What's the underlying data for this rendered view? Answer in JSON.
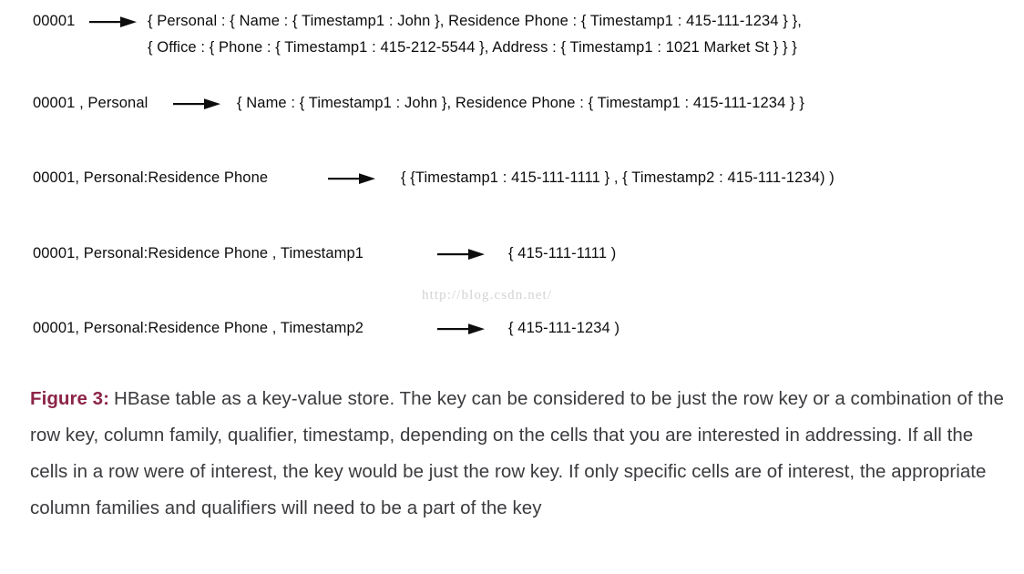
{
  "figure": {
    "mappings": [
      {
        "key": "00001",
        "arrow": "right-arrow-icon",
        "value_lines": [
          "{ Personal : { Name : { Timestamp1 : John }, Residence Phone : { Timestamp1 : 415-111-1234 } },",
          "{ Office : { Phone : { Timestamp1 : 415-212-5544 }, Address : { Timestamp1 : 1021 Market St } } }"
        ]
      },
      {
        "key": "00001 , Personal",
        "arrow": "right-arrow-icon",
        "value_lines": [
          "{ Name : { Timestamp1 : John }, Residence Phone : { Timestamp1 : 415-111-1234 } }"
        ]
      },
      {
        "key": "00001, Personal:Residence Phone",
        "arrow": "right-arrow-icon",
        "value_lines": [
          "{ {Timestamp1 : 415-111-1111 } , { Timestamp2 : 415-111-1234) )"
        ]
      },
      {
        "key": "00001, Personal:Residence Phone , Timestamp1",
        "arrow": "right-arrow-icon",
        "value_lines": [
          "{ 415-111-1111 )"
        ]
      },
      {
        "key": "00001, Personal:Residence Phone , Timestamp2",
        "arrow": "right-arrow-icon",
        "value_lines": [
          "{ 415-111-1234 )"
        ]
      }
    ],
    "watermark": "http://blog.csdn.net/",
    "caption": {
      "label": "Figure 3:",
      "text": "HBase table as a key-value store. The key can be considered to be just the row key or a combination of the row key, column family, qualifier, timestamp, depending on the cells that you are interested in addressing. If all the cells in a row were of interest, the key would be just the row key. If only specific cells are of interest, the appropriate column families and qualifiers will need to be a part of the key"
    },
    "colors": {
      "label_accent": "#8c2448",
      "caption_text": "#3b3b3f",
      "diagram_text": "#0d0d0d",
      "watermark": "#d3d3d6",
      "background": "#ffffff"
    }
  }
}
